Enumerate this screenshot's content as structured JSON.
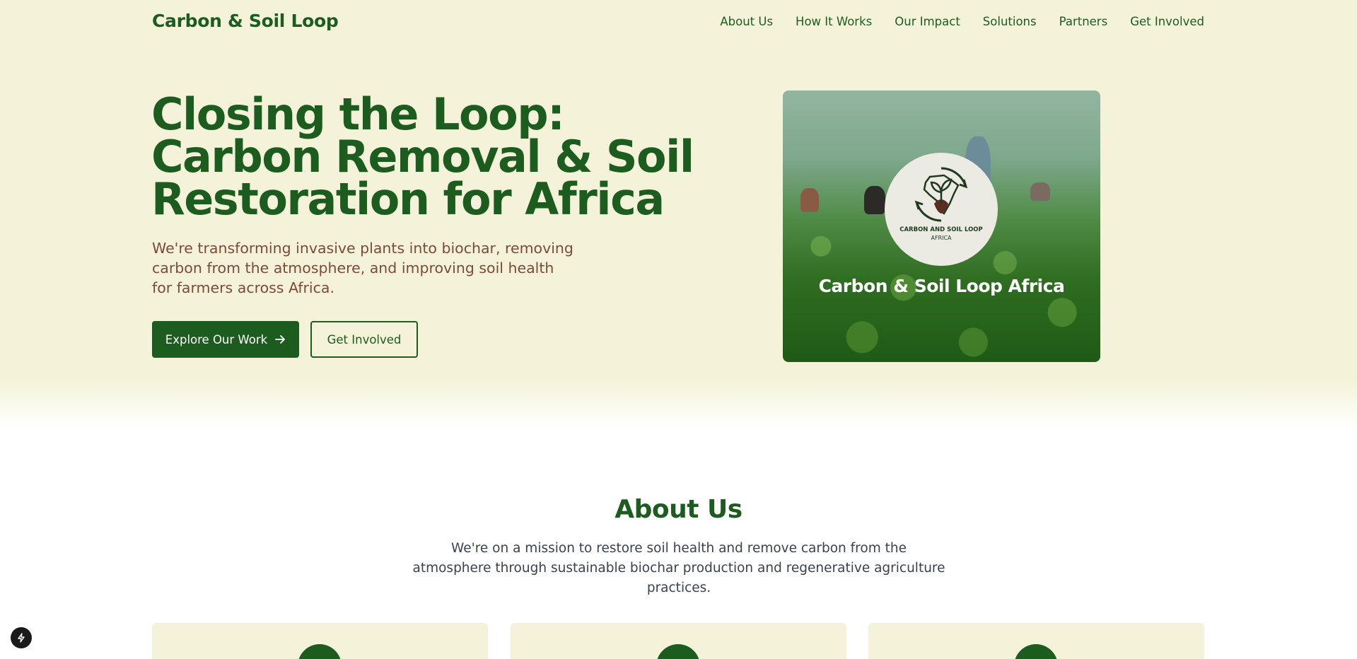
{
  "header": {
    "brand": "Carbon & Soil Loop",
    "nav": [
      "About Us",
      "How It Works",
      "Our Impact",
      "Solutions",
      "Partners",
      "Get Involved"
    ]
  },
  "hero": {
    "title_lines": [
      "Closing the Loop:",
      "Carbon Removal & Soil",
      "Restoration for Africa"
    ],
    "subtitle": "We're transforming invasive plants into biochar, removing carbon from the atmosphere, and improving soil health for farmers across Africa.",
    "primary_button": "Explore Our Work",
    "primary_button_icon": "arrow-right-icon",
    "secondary_button": "Get Involved",
    "card": {
      "logo_line1": "CARBON AND SOIL LOOP",
      "logo_line2": "AFRICA",
      "caption": "Carbon & Soil Loop Africa"
    }
  },
  "about": {
    "title": "About Us",
    "text": "We're on a mission to restore soil health and remove carbon from the atmosphere through sustainable biochar production and regenerative agriculture practices."
  },
  "colors": {
    "brand_green": "#1d5c1f",
    "hero_background": "#f4f3da",
    "subtitle_brown": "#7b4b3a"
  },
  "floating_button_icon": "lightning-icon"
}
